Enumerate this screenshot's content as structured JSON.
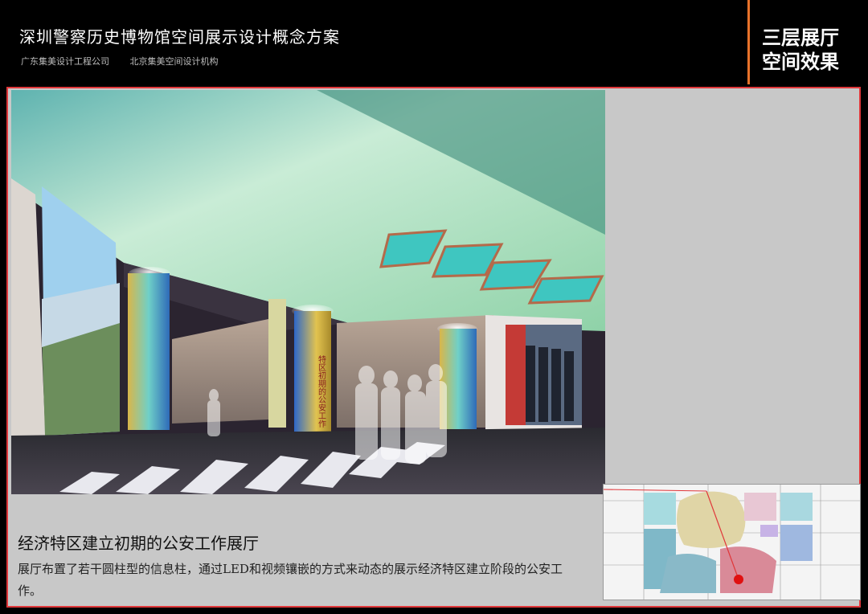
{
  "header": {
    "title": "深圳警察历史博物馆空间展示设计概念方案",
    "companies": [
      "广东集美设计工程公司",
      "北京集美空间设计机构"
    ],
    "section_label_line1": "三层展厅",
    "section_label_line2": "空间效果"
  },
  "render": {
    "column_sign": "特区初期的公安工作"
  },
  "caption": {
    "heading": "经济特区建立初期的公安工作展厅",
    "body": "展厅布置了若干圆柱型的信息柱，通过LED和视频镶嵌的方式来动态的展示经济特区建立阶段的公安工作。"
  },
  "colors": {
    "accent_orange": "#e8722a",
    "frame_red": "#e0373a",
    "panel_gray": "#c8c8c8"
  }
}
